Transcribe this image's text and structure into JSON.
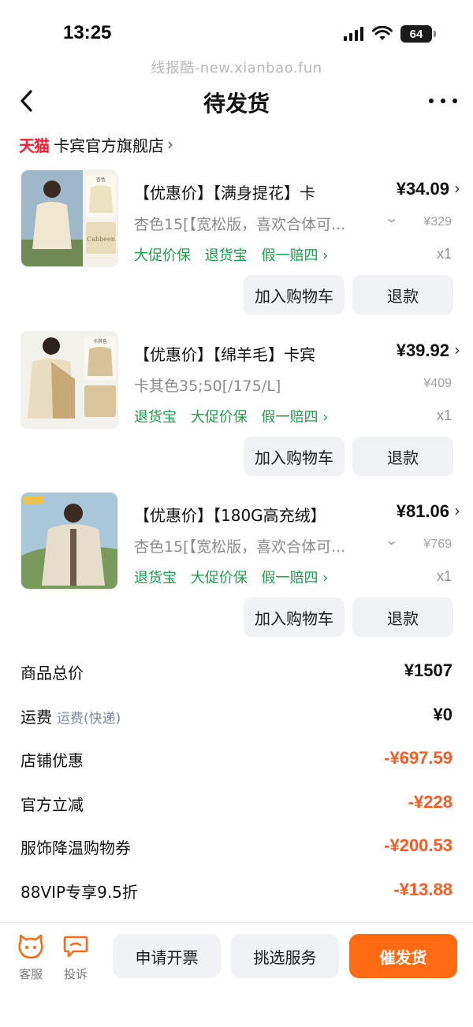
{
  "status_bar": {
    "time": "13:25",
    "battery": "64"
  },
  "watermark": "线报酷-new.xianbao.fun",
  "nav": {
    "title": "待发货"
  },
  "shop": {
    "platform": "天猫",
    "name": "卡宾官方旗舰店",
    "chevron": "›"
  },
  "items": [
    {
      "title": "【优惠价】【满身提花】卡",
      "price": "¥34.09",
      "sku": "杏色15[【宽松版，喜欢合体可...",
      "has_sku_dropdown": true,
      "original_price": "¥329",
      "tags": [
        "大促价保",
        "退货宝",
        "假一赔四 ›"
      ],
      "qty": "x1",
      "thumb_label": "杏色",
      "cart_label": "加入购物车",
      "refund_label": "退款"
    },
    {
      "title": "【优惠价】【绵羊毛】卡宾",
      "price": "¥39.92",
      "sku": "卡其色35;50[/175/L]",
      "has_sku_dropdown": false,
      "original_price": "¥409",
      "tags": [
        "退货宝",
        "大促价保",
        "假一赔四 ›"
      ],
      "qty": "x1",
      "thumb_label": "卡其色",
      "cart_label": "加入购物车",
      "refund_label": "退款"
    },
    {
      "title": "【优惠价】【180G高充绒】",
      "price": "¥81.06",
      "sku": "杏色15[【宽松版，喜欢合体可...",
      "has_sku_dropdown": true,
      "original_price": "¥769",
      "tags": [
        "退货宝",
        "大促价保",
        "假一赔四 ›"
      ],
      "qty": "x1",
      "thumb_label": "",
      "cart_label": "加入购物车",
      "refund_label": "退款"
    }
  ],
  "summary": [
    {
      "label": "商品总价",
      "sub": "",
      "value": "¥1507",
      "negative": false
    },
    {
      "label": "运费",
      "sub": "运费(快递)",
      "value": "¥0",
      "negative": false
    },
    {
      "label": "店铺优惠",
      "sub": "",
      "value": "-¥697.59",
      "negative": true
    },
    {
      "label": "官方立减",
      "sub": "",
      "value": "-¥228",
      "negative": true
    },
    {
      "label": "服饰降温购物券",
      "sub": "",
      "value": "-¥200.53",
      "negative": true
    },
    {
      "label": "88VIP专享9.5折",
      "sub": "",
      "value": "-¥13.88",
      "negative": true
    }
  ],
  "bottom": {
    "service_label": "客服",
    "complain_label": "投诉",
    "invoice_label": "申请开票",
    "pick_service_label": "挑选服务",
    "urge_label": "催发货"
  },
  "colors": {
    "accent": "#ff6a12",
    "discount": "#ff5a1f",
    "tag_green": "#19a04a",
    "tmall_red": "#ff1a2e"
  }
}
